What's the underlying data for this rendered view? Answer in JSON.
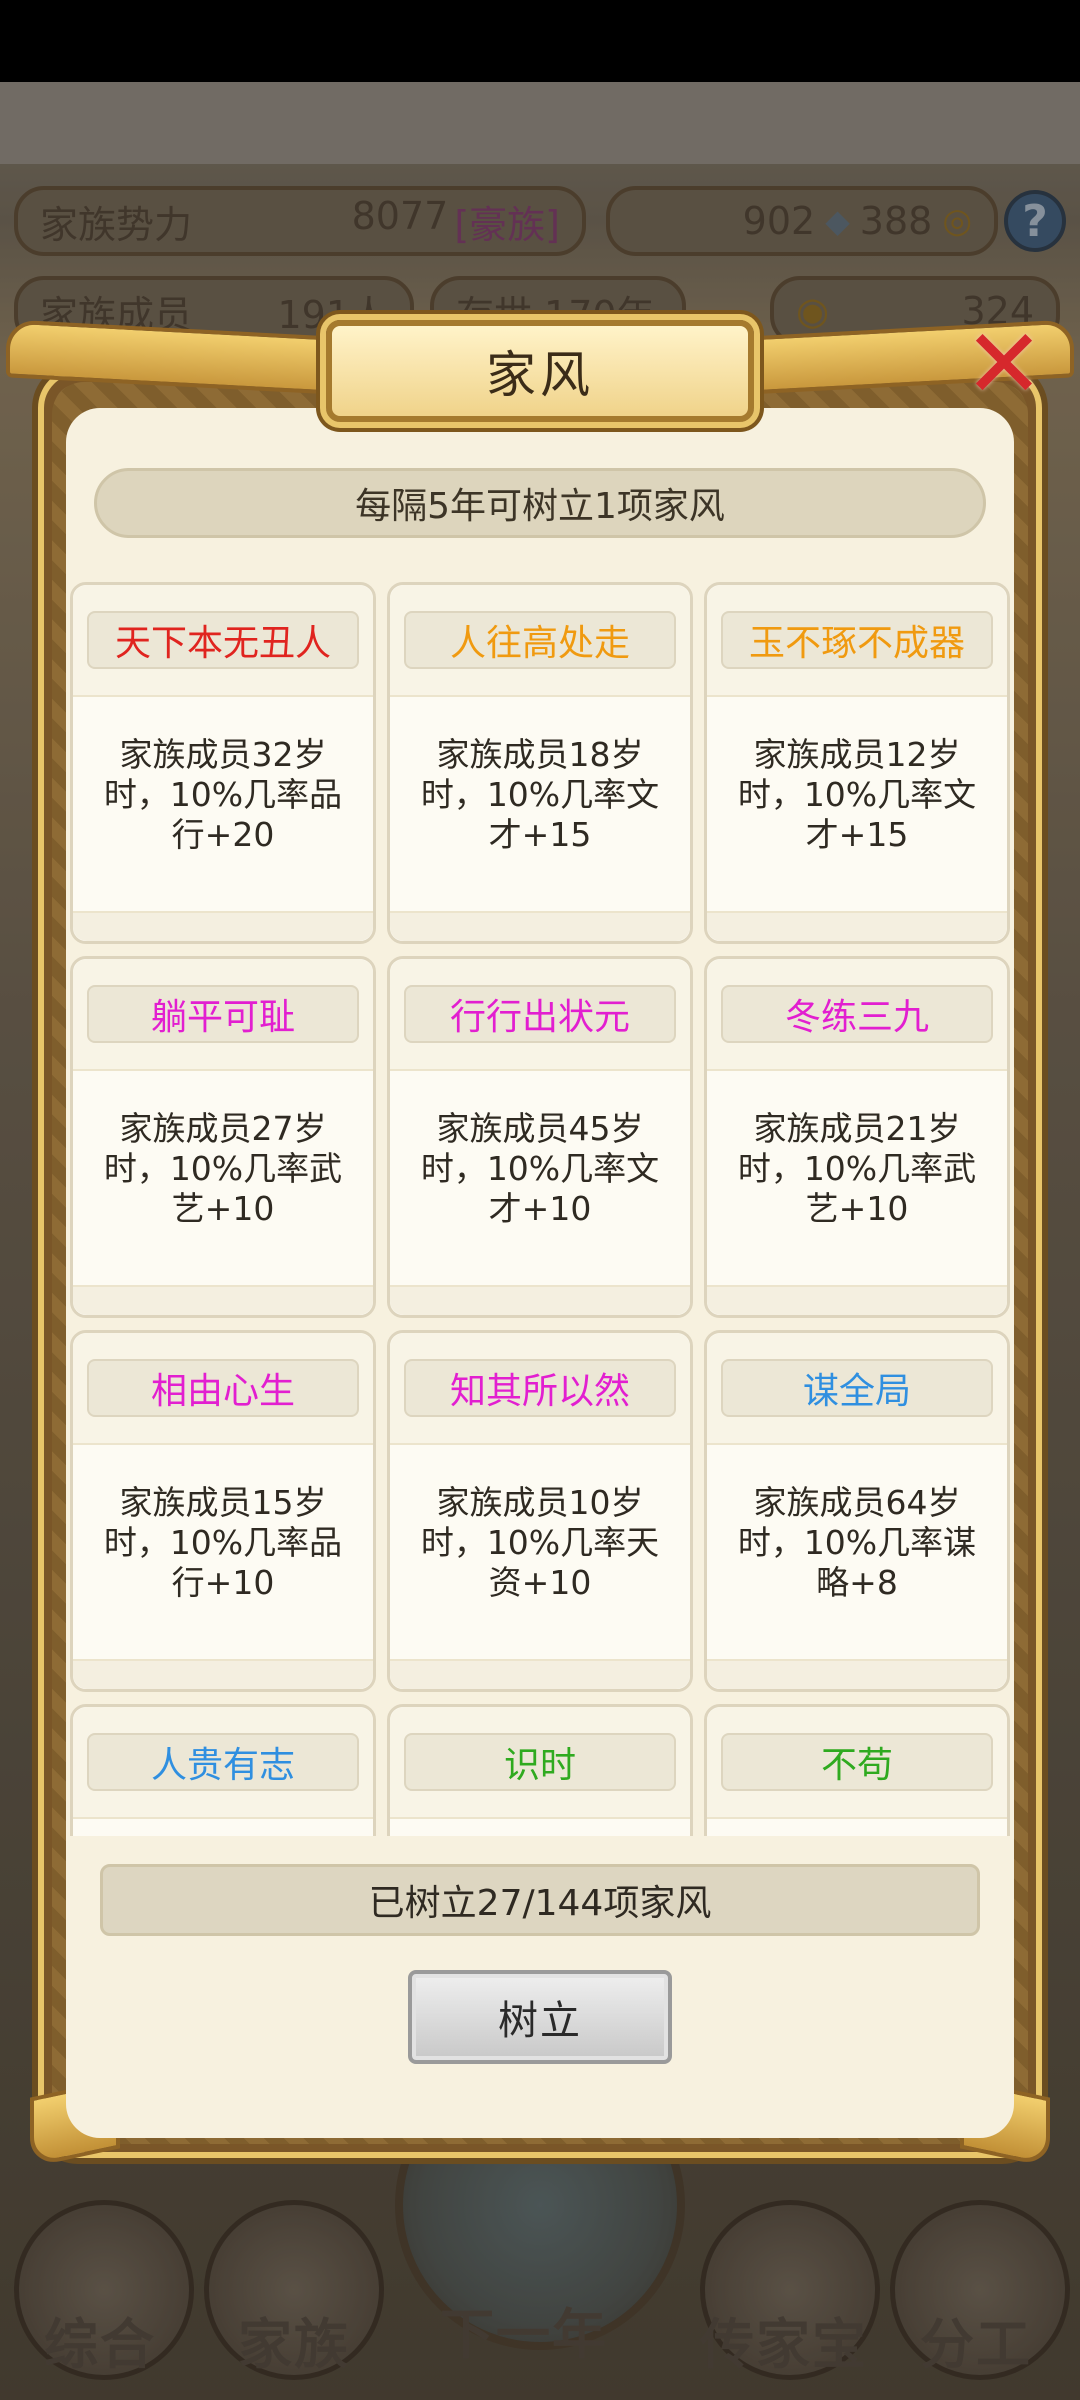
{
  "hud": {
    "power_label": "家族势力",
    "power_value": "8077",
    "power_rank": "[豪族]",
    "currency_a": "902",
    "currency_b": "388",
    "members_label": "家族成员",
    "members_value": "191人",
    "years_label": "存世",
    "years_value": "170年",
    "gold_value": "324",
    "help_glyph": "?"
  },
  "modal": {
    "title": "家风",
    "close_glyph": "✕",
    "hint": "每隔5年可树立1项家风",
    "progress": "已树立27/144项家风",
    "action_label": "树立"
  },
  "colors": {
    "red": "#e0241f",
    "orange": "#f09a10",
    "magenta": "#e21fd0",
    "blue": "#2f8fe0",
    "green": "#2faa1f"
  },
  "cards": [
    {
      "name": "天下本无丑人",
      "color": "#e0241f",
      "desc": "家族成员32岁时，10%几率品行+20"
    },
    {
      "name": "人往高处走",
      "color": "#f09a10",
      "desc": "家族成员18岁时，10%几率文才+15"
    },
    {
      "name": "玉不琢不成器",
      "color": "#f09a10",
      "desc": "家族成员12岁时，10%几率文才+15"
    },
    {
      "name": "躺平可耻",
      "color": "#e21fd0",
      "desc": "家族成员27岁时，10%几率武艺+10"
    },
    {
      "name": "行行出状元",
      "color": "#e21fd0",
      "desc": "家族成员45岁时，10%几率文才+10"
    },
    {
      "name": "冬练三九",
      "color": "#e21fd0",
      "desc": "家族成员21岁时，10%几率武艺+10"
    },
    {
      "name": "相由心生",
      "color": "#e21fd0",
      "desc": "家族成员15岁时，10%几率品行+10"
    },
    {
      "name": "知其所以然",
      "color": "#e21fd0",
      "desc": "家族成员10岁时，10%几率天资+10"
    },
    {
      "name": "谋全局",
      "color": "#2f8fe0",
      "desc": "家族成员64岁时，10%几率谋略+8"
    },
    {
      "name": "人贵有志",
      "color": "#2f8fe0",
      "desc": ""
    },
    {
      "name": "识时",
      "color": "#2faa1f",
      "desc": ""
    },
    {
      "name": "不苟",
      "color": "#2faa1f",
      "desc": ""
    }
  ],
  "nav": {
    "items": [
      "综合",
      "家族",
      "下一年",
      "传家宝",
      "分工"
    ]
  }
}
